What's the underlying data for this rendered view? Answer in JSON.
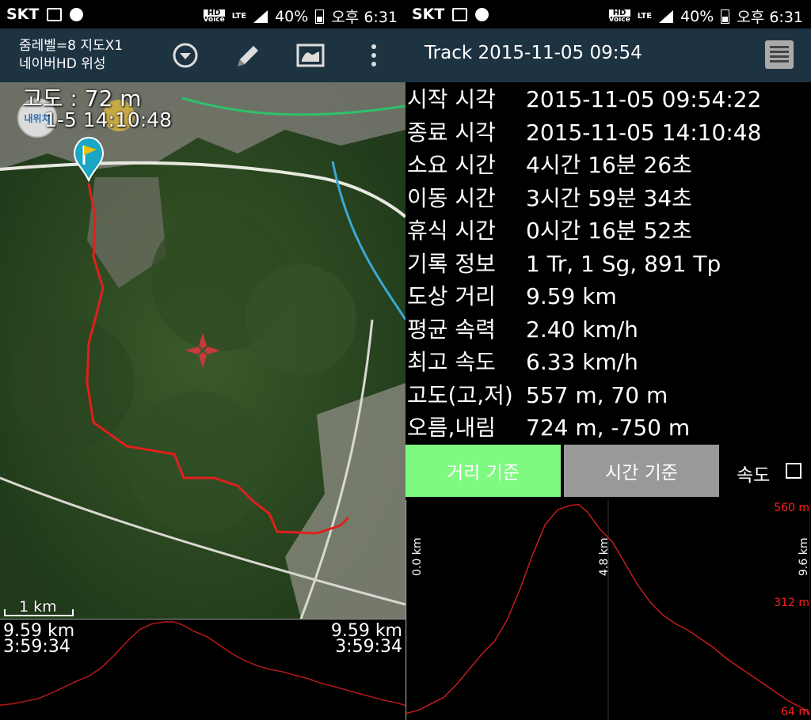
{
  "status_left": {
    "carrier": "SKT",
    "battery": "40%",
    "time": "오후 6:31",
    "hd": "HD",
    "voice": "Voice",
    "lte": "LTE"
  },
  "status_right": {
    "carrier": "SKT",
    "battery": "40%",
    "time": "오후 6:31",
    "hd": "HD",
    "voice": "Voice",
    "lte": "LTE"
  },
  "map_view": {
    "zoom_line": "줌레벨=8 지도X1",
    "map_type": "네이버HD 위성",
    "altitude": "고도 : 72 m",
    "time_overlay": "1-5 14:10:48",
    "my_location_label": "내위치",
    "scale_label": "1 km",
    "profile_left_distance": "9.59 km",
    "profile_left_time": "3:59:34",
    "profile_right_distance": "9.59 km",
    "profile_right_time": "3:59:34",
    "track_color": "#e0201c"
  },
  "track": {
    "title": "Track 2015-11-05 09:54",
    "stats": [
      {
        "label": "시작 시각",
        "value": "2015-11-05 09:54:22"
      },
      {
        "label": "종료 시각",
        "value": "2015-11-05 14:10:48"
      },
      {
        "label": "소요 시간",
        "value": "4시간 16분 26초"
      },
      {
        "label": "이동 시간",
        "value": "3시간 59분 34초"
      },
      {
        "label": "휴식 시간",
        "value": "0시간 16분 52초"
      },
      {
        "label": "기록 정보",
        "value": "1 Tr, 1 Sg, 891 Tp"
      },
      {
        "label": "도상 거리",
        "value": "9.59 km"
      },
      {
        "label": "평균 속력",
        "value": "2.40 km/h"
      },
      {
        "label": "최고 속도",
        "value": "6.33 km/h"
      },
      {
        "label": "고도(고,저)",
        "value": "557 m, 70 m"
      },
      {
        "label": "오름,내림",
        "value": "724 m, -750 m"
      }
    ],
    "btn_distance": "거리 기준",
    "btn_time": "시간 기준",
    "speed_label": "속도",
    "accent_green": "#7dfa7f"
  },
  "chart_data": {
    "type": "line",
    "title": "",
    "xlabel": "",
    "ylabel": "",
    "x_ticks": [
      "0.0 km",
      "4.8 km",
      "9.6 km"
    ],
    "y_ticks": [
      "560 m",
      "312 m",
      "64 m"
    ],
    "xlim": [
      0,
      9.6
    ],
    "ylim": [
      64,
      560
    ],
    "series": [
      {
        "x": [
          0.0,
          0.3,
          0.6,
          0.9,
          1.2,
          1.5,
          1.8,
          2.1,
          2.4,
          2.7,
          3.0,
          3.3,
          3.6,
          3.9,
          4.1,
          4.3,
          4.6,
          4.9,
          5.2,
          5.5,
          5.8,
          6.1,
          6.4,
          6.7,
          7.0,
          7.3,
          7.6,
          7.9,
          8.2,
          8.5,
          8.8,
          9.1,
          9.4,
          9.6
        ],
        "y": [
          72,
          80,
          95,
          110,
          140,
          175,
          210,
          240,
          290,
          360,
          440,
          510,
          545,
          555,
          557,
          540,
          500,
          470,
          420,
          370,
          330,
          300,
          280,
          265,
          245,
          225,
          200,
          180,
          160,
          140,
          120,
          100,
          85,
          70
        ]
      }
    ]
  }
}
